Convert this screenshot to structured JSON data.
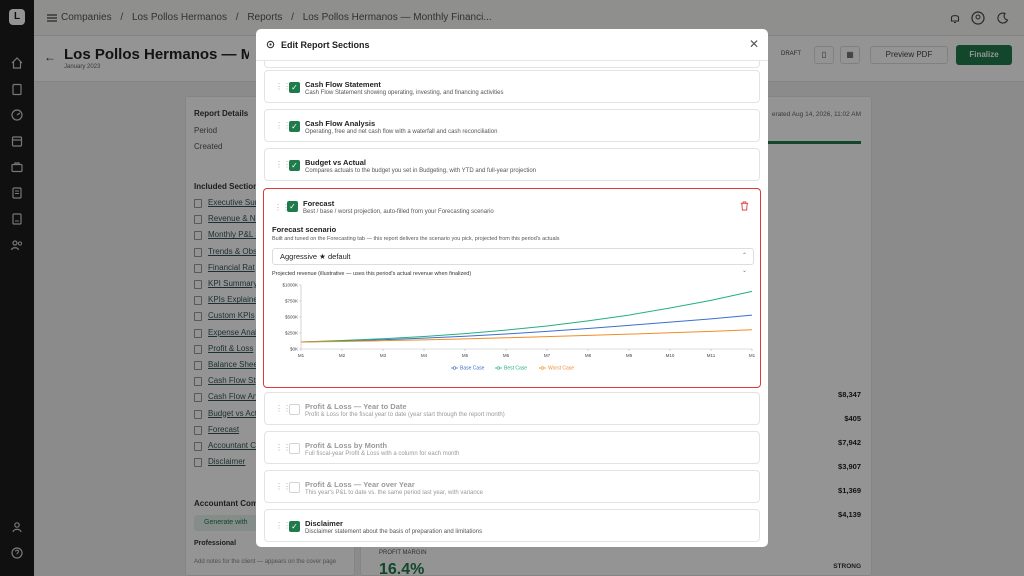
{
  "breadcrumb": {
    "items": [
      "Companies",
      "/",
      "Los Pollos Hermanos",
      "/",
      "Reports",
      "/",
      "Los Pollos Hermanos — Monthly Financi..."
    ]
  },
  "page": {
    "title": "Los Pollos Hermanos — Month",
    "subtitle": "January 2023",
    "draft_badge": "DRAFT",
    "preview_label": "Preview PDF",
    "finalize_label": "Finalize",
    "generated_label": "erated Aug 14, 2026, 11:02 AM"
  },
  "details": {
    "heading": "Report Details",
    "period_label": "Period",
    "created_label": "Created",
    "sections_heading": "Included Section",
    "links": [
      "Executive Sum",
      "Revenue & Ne",
      "Monthly P&L S",
      "Trends & Obs",
      "Financial Rat",
      "KPI Summary",
      "KPIs Explaine",
      "Custom KPIs",
      "Expense Anal",
      "Profit & Loss",
      "Balance Shee",
      "Cash Flow St",
      "Cash Flow Ana",
      "Budget vs Act",
      "Forecast",
      "Accountant C",
      "Disclaimer"
    ],
    "accountant_heading": "Accountant Com",
    "generate_label": "Generate with",
    "tab_professional": "Professional",
    "notes_hint": "Add notes for the client — appears on the cover page"
  },
  "values": [
    "$8,347",
    "$405",
    "$7,942",
    "$3,907",
    "$1,369",
    "$4,139"
  ],
  "profit": {
    "label": "PROFIT MARGIN",
    "value": "16.4%",
    "badge": "STRONG"
  },
  "modal": {
    "title": "Edit Report Sections",
    "sections": [
      {
        "title": "Cash Flow Statement",
        "desc": "Cash Flow Statement showing operating, investing, and financing activities",
        "checked": true
      },
      {
        "title": "Cash Flow Analysis",
        "desc": "Operating, free and net cash flow with a waterfall and cash reconciliation",
        "checked": true
      },
      {
        "title": "Budget vs Actual",
        "desc": "Compares actuals to the budget you set in Budgeting, with YTD and full-year projection",
        "checked": true
      },
      {
        "title": "Forecast",
        "desc": "Best / base / worst projection, auto-filled from your Forecasting scenario",
        "checked": true
      },
      {
        "title": "Profit & Loss — Year to Date",
        "desc": "Profit & Loss for the fiscal year to date (year start through the report month)",
        "checked": false
      },
      {
        "title": "Profit & Loss by Month",
        "desc": "Full fiscal-year Profit & Loss with a column for each month",
        "checked": false
      },
      {
        "title": "Profit & Loss — Year over Year",
        "desc": "This year's P&L to date vs. the same period last year, with variance",
        "checked": false
      },
      {
        "title": "Disclaimer",
        "desc": "Disclaimer statement about the basis of preparation and limitations",
        "checked": true
      }
    ],
    "forecast": {
      "scenario_label": "Forecast scenario",
      "scenario_desc": "Built and tuned on the Forecasting tab — this report delivers the scenario you pick, projected from this period's actuals",
      "scenario_value": "Aggressive ★ default",
      "chart_caption": "Projected revenue (illustrative — uses this period's actual revenue when finalized)"
    }
  },
  "chart_data": {
    "type": "line",
    "x": [
      "M1",
      "M2",
      "M3",
      "M4",
      "M5",
      "M6",
      "M7",
      "M8",
      "M9",
      "M10",
      "M11",
      "M1"
    ],
    "y_ticks": [
      "$0K",
      "$250K",
      "$500K",
      "$750K",
      "$1000K"
    ],
    "ylim": [
      0,
      1000
    ],
    "series": [
      {
        "name": "Base Case",
        "color": "#3b6fd1",
        "values": [
          110,
          125,
          145,
          170,
          200,
          235,
          275,
          320,
          370,
          420,
          470,
          530
        ]
      },
      {
        "name": "Best Case",
        "color": "#22b07d",
        "values": [
          110,
          132,
          160,
          195,
          240,
          295,
          360,
          440,
          530,
          640,
          760,
          900
        ]
      },
      {
        "name": "Worst Case",
        "color": "#f28c28",
        "values": [
          110,
          118,
          130,
          143,
          158,
          175,
          193,
          212,
          232,
          253,
          275,
          300
        ]
      }
    ],
    "grid": false,
    "legend": "bottom"
  }
}
